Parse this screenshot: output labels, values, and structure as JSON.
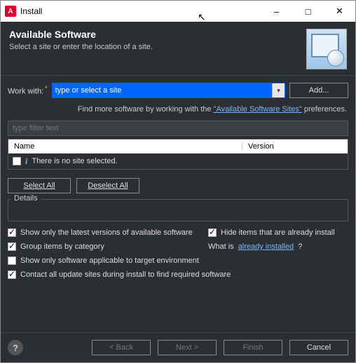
{
  "window": {
    "title": "Install"
  },
  "header": {
    "title": "Available Software",
    "subtitle": "Select a site or enter the location of a site."
  },
  "workWith": {
    "label": "Work with:",
    "value": "type or select a site",
    "addButton": "Add..."
  },
  "hint": {
    "prefix": "Find more software by working with the ",
    "link": "\"Available Software Sites\"",
    "suffix": " preferences."
  },
  "filter": {
    "placeholder": "type filter text"
  },
  "table": {
    "colName": "Name",
    "colVersion": "Version",
    "emptyMsg": "There is no site selected."
  },
  "buttons": {
    "selectAll": "Select All",
    "deselectAll": "Deselect All"
  },
  "details": {
    "legend": "Details"
  },
  "options": {
    "latest": "Show only the latest versions of available software",
    "hide": "Hide items that are already install",
    "group": "Group items by category",
    "whatIsPrefix": "What is ",
    "whatIsLink": "already installed",
    "whatIsSuffix": "?",
    "applicable": "Show only software applicable to target environment",
    "contact": "Contact all update sites during install to find required software"
  },
  "footer": {
    "back": "< Back",
    "next": "Next >",
    "finish": "Finish",
    "cancel": "Cancel"
  }
}
